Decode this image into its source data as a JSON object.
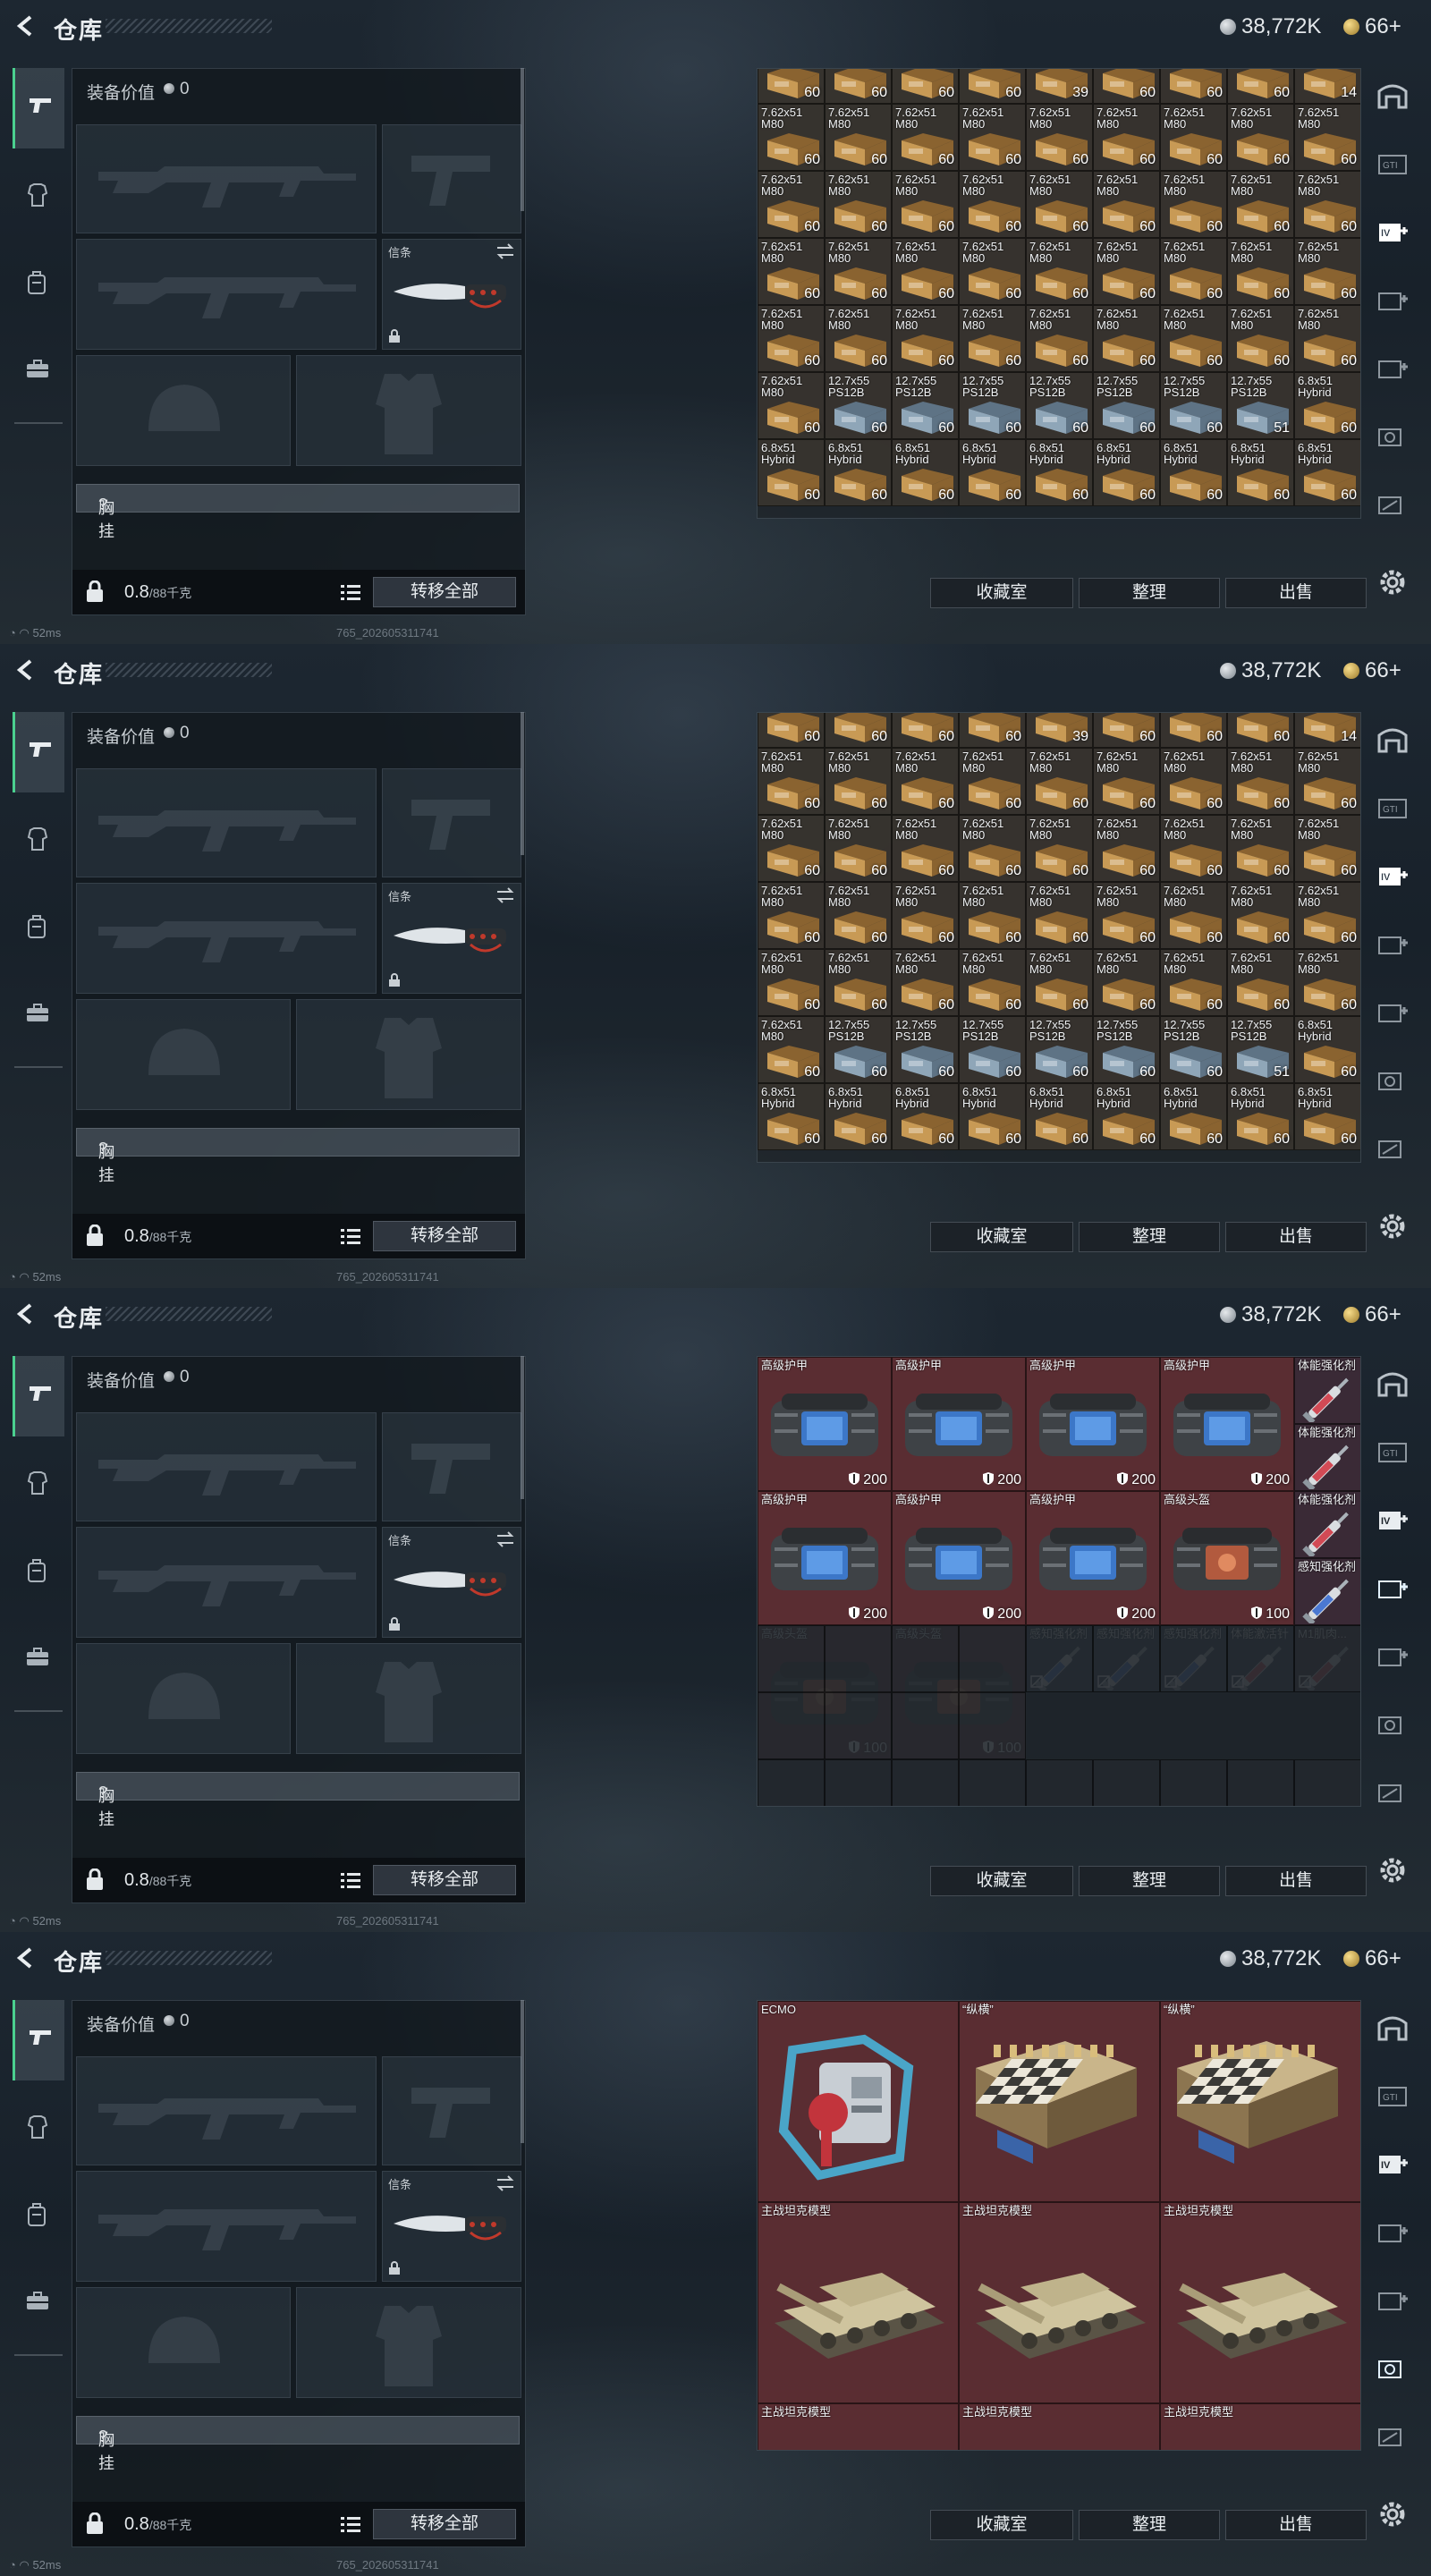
{
  "screen": {
    "title": "仓库",
    "currency_silver": "38,772K",
    "currency_gold": "66+",
    "equipment_value_label": "装备价值",
    "equipment_value": "0",
    "knife_tag": "信条",
    "vest_label": "胸挂",
    "vest_hint": "?",
    "weight_value": "0.8",
    "weight_max": "/88千克",
    "transfer_all": "转移全部",
    "btn_collection": "收藏室",
    "btn_sort": "整理",
    "btn_sell": "出售",
    "ping": "52ms",
    "build": "765_202605311741"
  },
  "left_tab_icons": [
    "pistol-icon",
    "armor-icon",
    "backpack-icon",
    "briefcase-icon"
  ],
  "right_tab_icons": [
    "helmet-tab-icon",
    "tab-icon-2",
    "tab-icon-3",
    "tab-icon-4",
    "tab-icon-5",
    "tab-icon-6",
    "tab-icon-7"
  ],
  "panels": [
    {
      "active_right_tab": 2,
      "ammo_rows": [
        {
          "label": "",
          "cells": [
            [
              "",
              "60"
            ],
            [
              "",
              "60"
            ],
            [
              "",
              "60"
            ],
            [
              "",
              "60"
            ],
            [
              "",
              "39"
            ],
            [
              "",
              "60"
            ],
            [
              "",
              "60"
            ],
            [
              "",
              "60"
            ],
            [
              "",
              "14"
            ]
          ]
        },
        {
          "cells": [
            [
              "7.62x51 M80",
              "60"
            ],
            [
              "7.62x51 M80",
              "60"
            ],
            [
              "7.62x51 M80",
              "60"
            ],
            [
              "7.62x51 M80",
              "60"
            ],
            [
              "7.62x51 M80",
              "60"
            ],
            [
              "7.62x51 M80",
              "60"
            ],
            [
              "7.62x51 M80",
              "60"
            ],
            [
              "7.62x51 M80",
              "60"
            ],
            [
              "7.62x51 M80",
              "60"
            ]
          ]
        },
        {
          "cells": [
            [
              "7.62x51 M80",
              "60"
            ],
            [
              "7.62x51 M80",
              "60"
            ],
            [
              "7.62x51 M80",
              "60"
            ],
            [
              "7.62x51 M80",
              "60"
            ],
            [
              "7.62x51 M80",
              "60"
            ],
            [
              "7.62x51 M80",
              "60"
            ],
            [
              "7.62x51 M80",
              "60"
            ],
            [
              "7.62x51 M80",
              "60"
            ],
            [
              "7.62x51 M80",
              "60"
            ]
          ]
        },
        {
          "cells": [
            [
              "7.62x51 M80",
              "60"
            ],
            [
              "7.62x51 M80",
              "60"
            ],
            [
              "7.62x51 M80",
              "60"
            ],
            [
              "7.62x51 M80",
              "60"
            ],
            [
              "7.62x51 M80",
              "60"
            ],
            [
              "7.62x51 M80",
              "60"
            ],
            [
              "7.62x51 M80",
              "60"
            ],
            [
              "7.62x51 M80",
              "60"
            ],
            [
              "7.62x51 M80",
              "60"
            ]
          ]
        },
        {
          "cells": [
            [
              "7.62x51 M80",
              "60"
            ],
            [
              "7.62x51 M80",
              "60"
            ],
            [
              "7.62x51 M80",
              "60"
            ],
            [
              "7.62x51 M80",
              "60"
            ],
            [
              "7.62x51 M80",
              "60"
            ],
            [
              "7.62x51 M80",
              "60"
            ],
            [
              "7.62x51 M80",
              "60"
            ],
            [
              "7.62x51 M80",
              "60"
            ],
            [
              "7.62x51 M80",
              "60"
            ]
          ]
        },
        {
          "cells": [
            [
              "7.62x51 M80",
              "60"
            ],
            [
              "12.7x55 PS12B",
              "60"
            ],
            [
              "12.7x55 PS12B",
              "60"
            ],
            [
              "12.7x55 PS12B",
              "60"
            ],
            [
              "12.7x55 PS12B",
              "60"
            ],
            [
              "12.7x55 PS12B",
              "60"
            ],
            [
              "12.7x55 PS12B",
              "60"
            ],
            [
              "12.7x55 PS12B",
              "51"
            ],
            [
              "6.8x51 Hybrid",
              "60"
            ]
          ]
        },
        {
          "cells": [
            [
              "6.8x51 Hybrid",
              "60"
            ],
            [
              "6.8x51 Hybrid",
              "60"
            ],
            [
              "6.8x51 Hybrid",
              "60"
            ],
            [
              "6.8x51 Hybrid",
              "60"
            ],
            [
              "6.8x51 Hybrid",
              "60"
            ],
            [
              "6.8x51 Hybrid",
              "60"
            ],
            [
              "6.8x51 Hybrid",
              "60"
            ],
            [
              "6.8x51 Hybrid",
              "60"
            ],
            [
              "6.8x51 Hybrid",
              "60"
            ]
          ]
        }
      ]
    },
    {
      "active_right_tab": 2,
      "ammo_rows": [
        {
          "cells": [
            [
              "",
              "60"
            ],
            [
              "",
              "60"
            ],
            [
              "",
              "60"
            ],
            [
              "",
              "60"
            ],
            [
              "",
              "39"
            ],
            [
              "",
              "60"
            ],
            [
              "",
              "60"
            ],
            [
              "",
              "60"
            ],
            [
              "",
              "14"
            ]
          ]
        },
        {
          "cells": [
            [
              "7.62x51 M80",
              "60"
            ],
            [
              "7.62x51 M80",
              "60"
            ],
            [
              "7.62x51 M80",
              "60"
            ],
            [
              "7.62x51 M80",
              "60"
            ],
            [
              "7.62x51 M80",
              "60"
            ],
            [
              "7.62x51 M80",
              "60"
            ],
            [
              "7.62x51 M80",
              "60"
            ],
            [
              "7.62x51 M80",
              "60"
            ],
            [
              "7.62x51 M80",
              "60"
            ]
          ]
        },
        {
          "cells": [
            [
              "7.62x51 M80",
              "60"
            ],
            [
              "7.62x51 M80",
              "60"
            ],
            [
              "7.62x51 M80",
              "60"
            ],
            [
              "7.62x51 M80",
              "60"
            ],
            [
              "7.62x51 M80",
              "60"
            ],
            [
              "7.62x51 M80",
              "60"
            ],
            [
              "7.62x51 M80",
              "60"
            ],
            [
              "7.62x51 M80",
              "60"
            ],
            [
              "7.62x51 M80",
              "60"
            ]
          ]
        },
        {
          "cells": [
            [
              "7.62x51 M80",
              "60"
            ],
            [
              "7.62x51 M80",
              "60"
            ],
            [
              "7.62x51 M80",
              "60"
            ],
            [
              "7.62x51 M80",
              "60"
            ],
            [
              "7.62x51 M80",
              "60"
            ],
            [
              "7.62x51 M80",
              "60"
            ],
            [
              "7.62x51 M80",
              "60"
            ],
            [
              "7.62x51 M80",
              "60"
            ],
            [
              "7.62x51 M80",
              "60"
            ]
          ]
        },
        {
          "cells": [
            [
              "7.62x51 M80",
              "60"
            ],
            [
              "7.62x51 M80",
              "60"
            ],
            [
              "7.62x51 M80",
              "60"
            ],
            [
              "7.62x51 M80",
              "60"
            ],
            [
              "7.62x51 M80",
              "60"
            ],
            [
              "7.62x51 M80",
              "60"
            ],
            [
              "7.62x51 M80",
              "60"
            ],
            [
              "7.62x51 M80",
              "60"
            ],
            [
              "7.62x51 M80",
              "60"
            ]
          ]
        },
        {
          "cells": [
            [
              "7.62x51 M80",
              "60"
            ],
            [
              "12.7x55 PS12B",
              "60"
            ],
            [
              "12.7x55 PS12B",
              "60"
            ],
            [
              "12.7x55 PS12B",
              "60"
            ],
            [
              "12.7x55 PS12B",
              "60"
            ],
            [
              "12.7x55 PS12B",
              "60"
            ],
            [
              "12.7x55 PS12B",
              "60"
            ],
            [
              "12.7x55 PS12B",
              "51"
            ],
            [
              "6.8x51 Hybrid",
              "60"
            ]
          ]
        },
        {
          "cells": [
            [
              "6.8x51 Hybrid",
              "60"
            ],
            [
              "6.8x51 Hybrid",
              "60"
            ],
            [
              "6.8x51 Hybrid",
              "60"
            ],
            [
              "6.8x51 Hybrid",
              "60"
            ],
            [
              "6.8x51 Hybrid",
              "60"
            ],
            [
              "6.8x51 Hybrid",
              "60"
            ],
            [
              "6.8x51 Hybrid",
              "60"
            ],
            [
              "6.8x51 Hybrid",
              "60"
            ],
            [
              "6.8x51 Hybrid",
              "60"
            ]
          ]
        }
      ]
    },
    {
      "active_right_tab": 3,
      "gear": [
        [
          "高级护甲",
          "200",
          0,
          0,
          "armor"
        ],
        [
          "高级护甲",
          "200",
          1,
          0,
          "armor"
        ],
        [
          "高级护甲",
          "200",
          2,
          0,
          "armor"
        ],
        [
          "高级护甲",
          "200",
          3,
          0,
          "armor"
        ],
        [
          "高级护甲",
          "200",
          0,
          1,
          "armor"
        ],
        [
          "高级护甲",
          "200",
          1,
          1,
          "armor"
        ],
        [
          "高级护甲",
          "200",
          2,
          1,
          "armor"
        ],
        [
          "高级头盔",
          "100",
          3,
          1,
          "helmet"
        ],
        [
          "高级头盔",
          "100",
          0,
          2,
          "helmet"
        ],
        [
          "高级头盔",
          "100",
          1,
          2,
          "helmet"
        ]
      ],
      "syringes": [
        [
          "体能强化剂",
          4,
          0,
          "red"
        ],
        [
          "体能强化剂",
          4,
          1,
          "red"
        ],
        [
          "体能强化剂",
          4,
          2,
          "red"
        ],
        [
          "感知强化剂",
          4,
          3,
          "blue"
        ],
        [
          "感知强化剂",
          2,
          4,
          "blue"
        ],
        [
          "感知强化剂",
          2.5,
          4,
          "blue"
        ],
        [
          "感知强化剂",
          3,
          4,
          "blue"
        ],
        [
          "体能激活针",
          3.5,
          4,
          "red"
        ],
        [
          "M1肌肉...",
          4,
          4,
          "red"
        ]
      ]
    },
    {
      "active_right_tab": 5,
      "valuables": [
        [
          "ECMO",
          0,
          0,
          "ecmo"
        ],
        [
          "“纵横”",
          1,
          0,
          "chess"
        ],
        [
          "“纵横”",
          2,
          0,
          "chess"
        ],
        [
          "主战坦克模型",
          0,
          1,
          "tank"
        ],
        [
          "主战坦克模型",
          1,
          1,
          "tank"
        ],
        [
          "主战坦克模型",
          2,
          1,
          "tank"
        ],
        [
          "主战坦克模型",
          0,
          2,
          "tank"
        ],
        [
          "主战坦克模型",
          1,
          2,
          "tank"
        ],
        [
          "主战坦克模型",
          2,
          2,
          "tank"
        ]
      ]
    }
  ],
  "colors": {
    "accent_green": "#4bd08f",
    "ammo_box": "#c89a55",
    "gear_bg": "#5a2d32",
    "ammo_blue": "#8fa6b8"
  }
}
